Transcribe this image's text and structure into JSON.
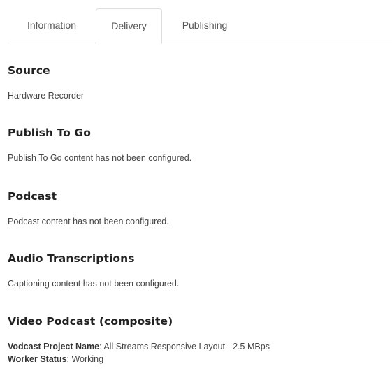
{
  "tabs": [
    {
      "label": "Information",
      "active": false
    },
    {
      "label": "Delivery",
      "active": true
    },
    {
      "label": "Publishing",
      "active": false
    }
  ],
  "sections": {
    "source": {
      "heading": "Source",
      "text": "Hardware Recorder"
    },
    "publish_to_go": {
      "heading": "Publish To Go",
      "text": "Publish To Go content has not been configured."
    },
    "podcast": {
      "heading": "Podcast",
      "text": "Podcast content has not been configured."
    },
    "audio_transcriptions": {
      "heading": "Audio Transcriptions",
      "text": "Captioning content has not been configured."
    },
    "video_podcast": {
      "heading": "Video Podcast (composite)",
      "project_name_label": "Vodcast Project Name",
      "project_name_value": ": All Streams Responsive Layout - 2.5 MBps",
      "worker_status_label": "Worker Status",
      "worker_status_value": ": Working"
    }
  },
  "colors": {
    "tab_border": "#dddddd",
    "heading_text": "#222222",
    "body_text": "#444444"
  }
}
